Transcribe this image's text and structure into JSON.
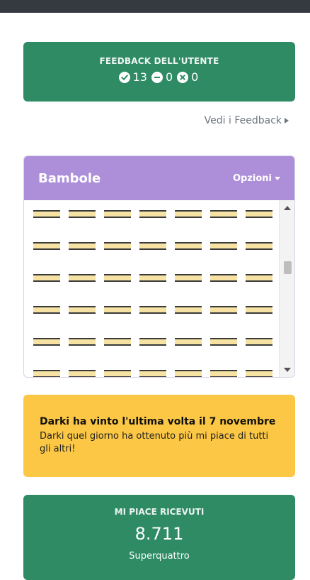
{
  "feedback": {
    "title": "FEEDBACK DELL'UTENTE",
    "positive": "13",
    "neutral": "0",
    "negative": "0"
  },
  "feedback_link": "Vedi i Feedback",
  "dolls": {
    "title": "Bambole",
    "options_label": "Opzioni",
    "grid_rows": 6,
    "grid_cols": 7
  },
  "winner": {
    "title": "Darki ha vinto l'ultima volta il 7 novembre",
    "description": "Darki quel giorno ha ottenuto più mi piace di tutti gli altri!"
  },
  "likes": {
    "label": "MI PIACE RICEVUTI",
    "value": "8.711",
    "subtitle": "Superquattro"
  },
  "colors": {
    "green": "#2e8b64",
    "purple": "#ad8fd9",
    "yellow": "#fbc744",
    "topbar": "#343a40"
  },
  "icons": [
    "check-circle-icon",
    "minus-circle-icon",
    "x-circle-icon",
    "caret-right-icon",
    "caret-down-icon"
  ]
}
